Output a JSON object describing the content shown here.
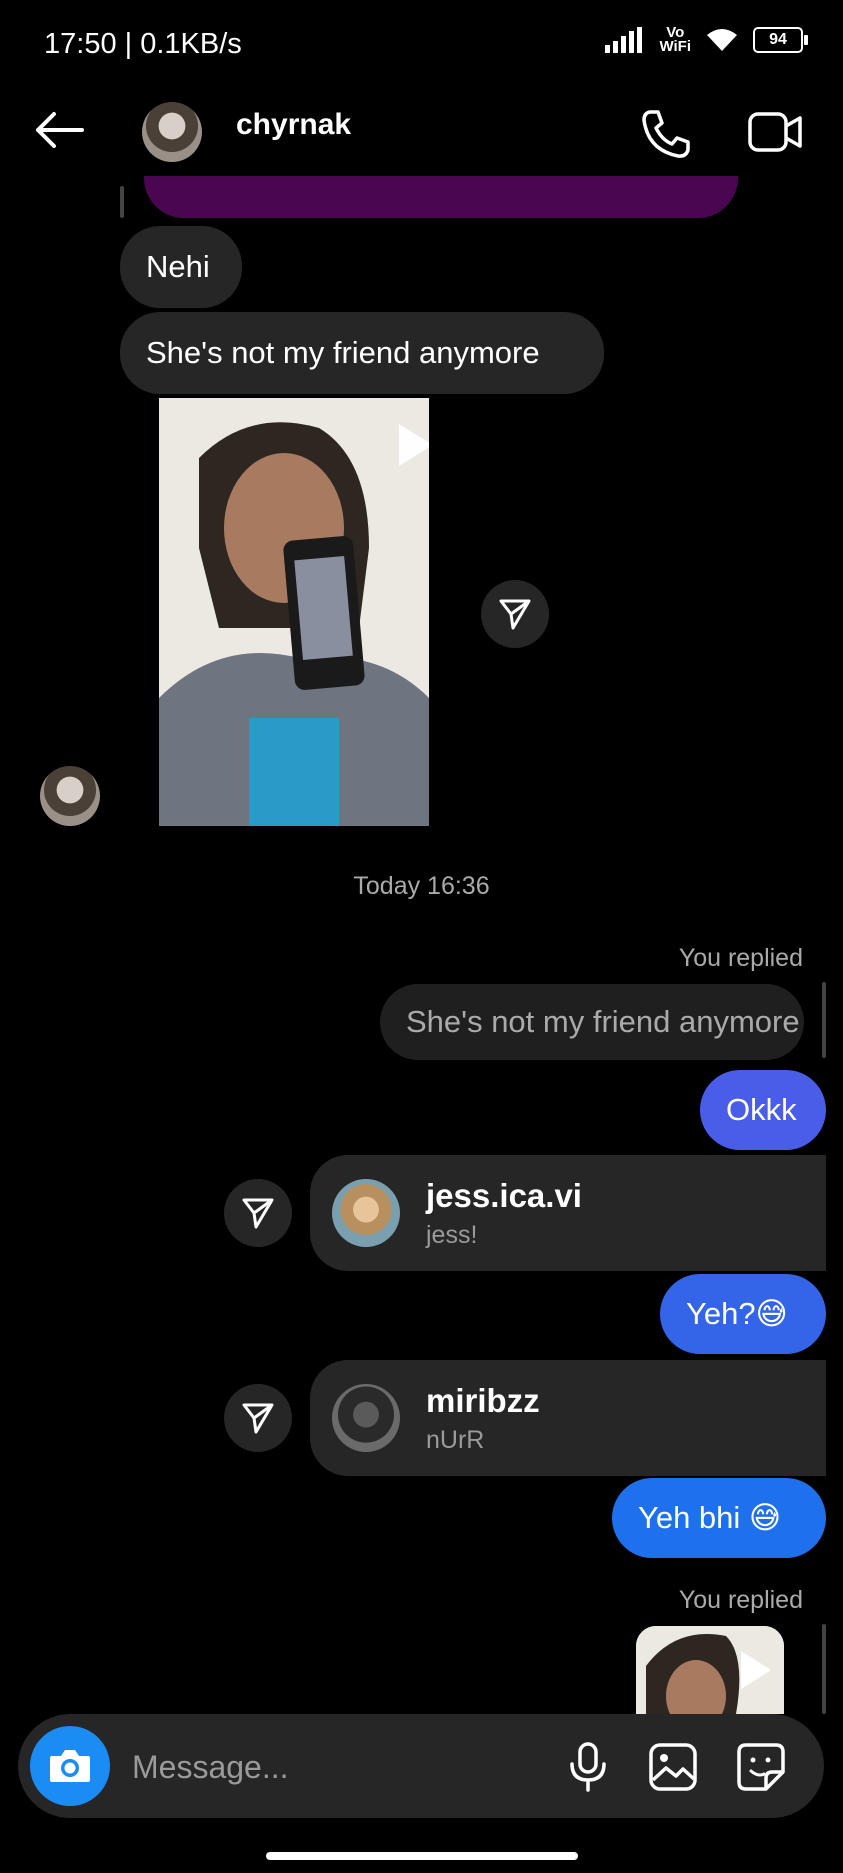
{
  "status_bar": {
    "time": "17:50 | 0.1KB/s",
    "vowifi_top": "Vo",
    "vowifi_bottom": "WiFi",
    "battery": "94"
  },
  "header": {
    "contact_name": "chyrnak",
    "back_icon": "back-arrow-icon",
    "call_icon": "phone-icon",
    "video_icon": "video-camera-icon"
  },
  "messages": {
    "in_1": "Nehi",
    "in_2": "She's not my friend anymore",
    "timestamp": "Today 16:36",
    "replied_label_1": "You replied",
    "quote_1": "She's not my friend anymore",
    "out_1": "Okkk",
    "profile_1": {
      "username": "jess.ica.vi",
      "name": "jess!"
    },
    "out_2": "Yeh?😅",
    "profile_2": {
      "username": "miribzz",
      "name": "nUrR"
    },
    "out_3": "Yeh bhi 😅",
    "replied_label_2": "You replied"
  },
  "composer": {
    "placeholder": "Message...",
    "mic_icon": "microphone-icon",
    "gallery_icon": "gallery-icon",
    "sticker_icon": "sticker-icon"
  },
  "colors": {
    "background": "#000000",
    "incoming": "#262626",
    "outgoing_1": "#4a5de8",
    "outgoing_2": "#3465e8",
    "outgoing_3": "#1f70ec",
    "camera_button": "#1c8cf5"
  }
}
